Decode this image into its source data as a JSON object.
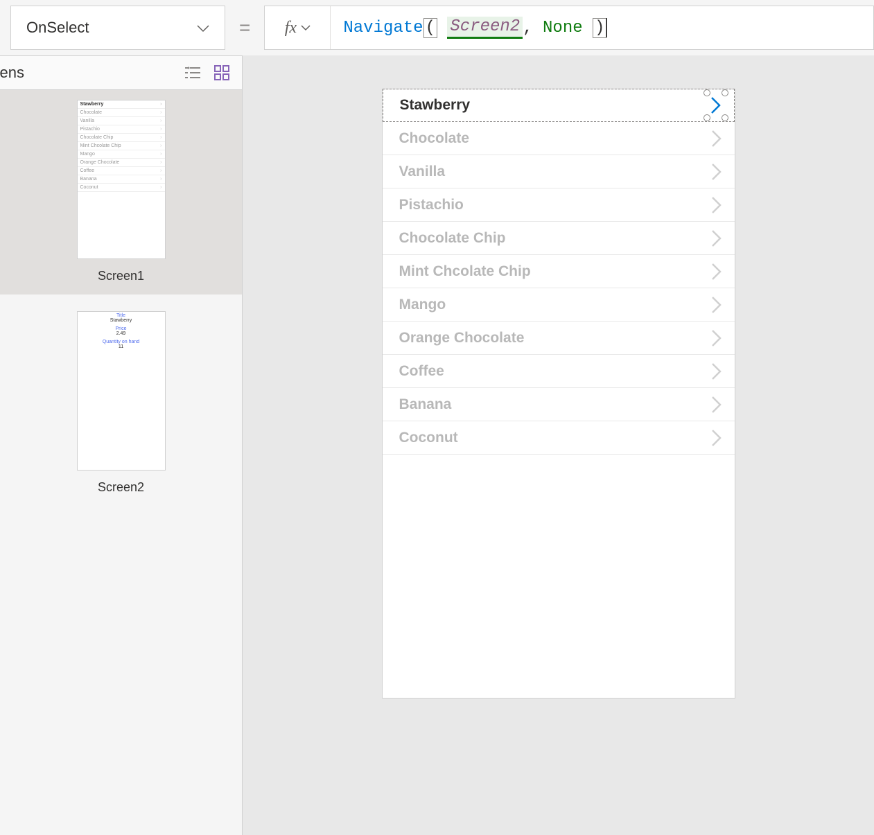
{
  "property_dropdown": {
    "value": "OnSelect"
  },
  "formula": {
    "fn": "Navigate",
    "arg1": "Screen2",
    "arg2": "None"
  },
  "left_panel": {
    "title": "reens",
    "screens": [
      {
        "name": "Screen1",
        "selected": true
      },
      {
        "name": "Screen2",
        "selected": false
      }
    ]
  },
  "thumb1_items": [
    "Stawberry",
    "Chocolate",
    "Vanilla",
    "Pistachio",
    "Chocolate Chip",
    "Mint Chcolate Chip",
    "Mango",
    "Orange Chocolate",
    "Coffee",
    "Banana",
    "Coconut"
  ],
  "thumb2_form": {
    "title_label": "Title",
    "title_val": "Stawberry",
    "price_label": "Price",
    "price_val": "2.49",
    "qty_label": "Quantity on hand",
    "qty_val": "11"
  },
  "gallery": {
    "items": [
      {
        "label": "Stawberry",
        "selected": true
      },
      {
        "label": "Chocolate"
      },
      {
        "label": "Vanilla"
      },
      {
        "label": "Pistachio"
      },
      {
        "label": "Chocolate Chip"
      },
      {
        "label": "Mint Chcolate Chip"
      },
      {
        "label": "Mango"
      },
      {
        "label": "Orange Chocolate"
      },
      {
        "label": "Coffee"
      },
      {
        "label": "Banana"
      },
      {
        "label": "Coconut"
      }
    ]
  }
}
